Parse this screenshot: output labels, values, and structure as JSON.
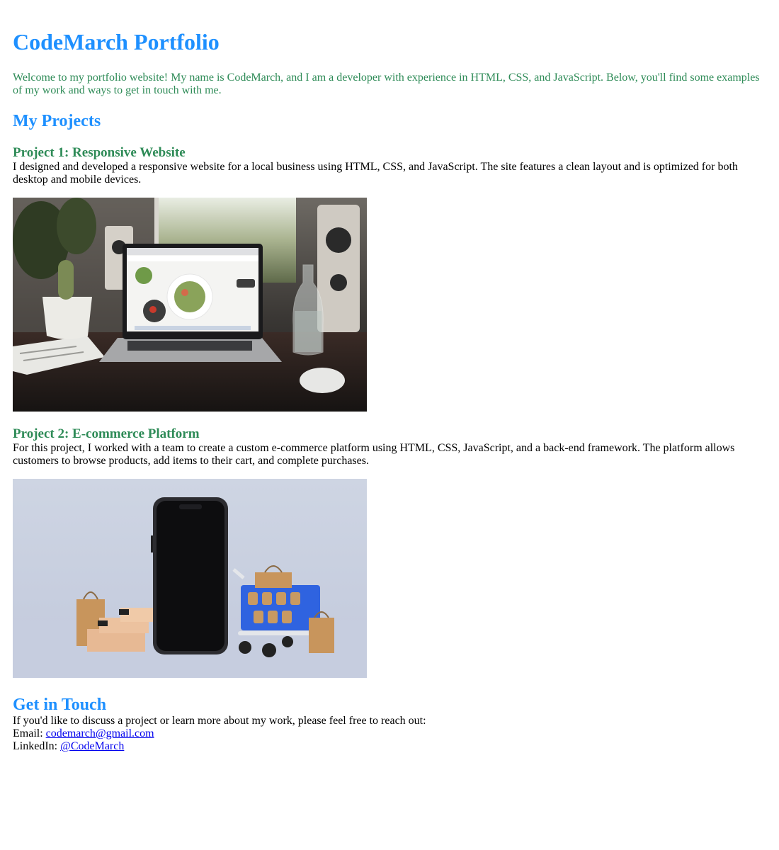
{
  "header": {
    "title": "CodeMarch Portfolio",
    "intro": "Welcome to my portfolio website! My name is CodeMarch, and I am a developer with experience in HTML, CSS, and JavaScript. Below, you'll find some examples of my work and ways to get in touch with me."
  },
  "projects": {
    "heading": "My Projects",
    "items": [
      {
        "title": "Project 1: Responsive Website",
        "description": "I designed and developed a responsive website for a local business using HTML, CSS, and JavaScript. The site features a clean layout and is optimized for both desktop and mobile devices."
      },
      {
        "title": "Project 2: E-commerce Platform",
        "description": "For this project, I worked with a team to create a custom e-commerce platform using HTML, CSS, JavaScript, and a back-end framework. The platform allows customers to browse products, add items to their cart, and complete purchases."
      }
    ]
  },
  "contact": {
    "heading": "Get in Touch",
    "text": "If you'd like to discuss a project or learn more about my work, please feel free to reach out:",
    "email_label": "Email: ",
    "email_value": "codemarch@gmail.com",
    "linkedin_label": "LinkedIn: ",
    "linkedin_value": "@CodeMarch"
  },
  "colors": {
    "heading_blue": "#1e90ff",
    "sub_green": "#2e8b57",
    "link_blue": "#0000ee"
  }
}
